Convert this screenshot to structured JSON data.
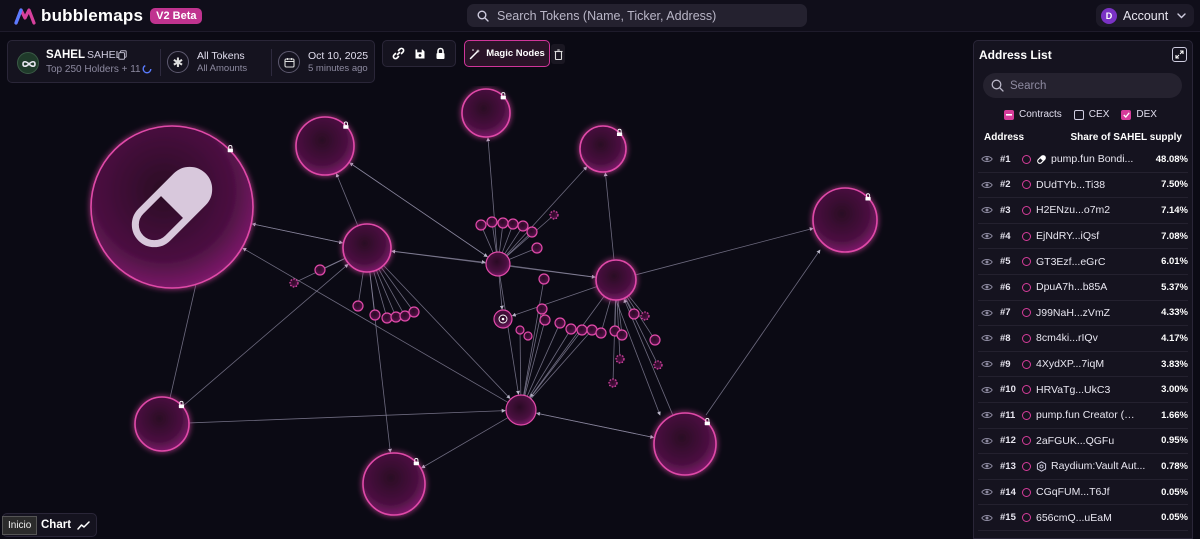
{
  "app": {
    "logo_text": "bubblemaps",
    "badge": "V2 Beta",
    "search_placeholder": "Search Tokens (Name, Ticker, Address)",
    "account_initial": "D",
    "account_label": "Account"
  },
  "token": {
    "name": "SAHEL",
    "ticker": "SAHEL",
    "holders": "Top 250 Holders + 11",
    "filter_label": "All Tokens",
    "filter_sub": "All Amounts",
    "date_label": "Oct 10, 2025",
    "date_sub": "5 minutes ago"
  },
  "toolbar": {
    "magic_nodes": "Magic Nodes"
  },
  "bottom": {
    "chart_label": "Chart",
    "tooltip": "Inicio"
  },
  "address_list": {
    "title": "Address List",
    "search_placeholder": "Search",
    "filters": [
      "Contracts",
      "CEX",
      "DEX"
    ],
    "col_address": "Address",
    "col_share": "Share of SAHEL supply",
    "rows": [
      {
        "rank": "#1",
        "name": "pump.fun Bondi...",
        "share": "48.08%",
        "icon": "pill-icon"
      },
      {
        "rank": "#2",
        "name": "DUdTYb...Ti38",
        "share": "7.50%"
      },
      {
        "rank": "#3",
        "name": "H2ENzu...o7m2",
        "share": "7.14%"
      },
      {
        "rank": "#4",
        "name": "EjNdRY...iQsf",
        "share": "7.08%"
      },
      {
        "rank": "#5",
        "name": "GT3Ezf...eGrC",
        "share": "6.01%"
      },
      {
        "rank": "#6",
        "name": "DpuA7h...b85A",
        "share": "5.37%"
      },
      {
        "rank": "#7",
        "name": "J99NaH...zVmZ",
        "share": "4.33%"
      },
      {
        "rank": "#8",
        "name": "8cm4ki...rIQv",
        "share": "4.17%"
      },
      {
        "rank": "#9",
        "name": "4XydXP...7iqM",
        "share": "3.83%"
      },
      {
        "rank": "#10",
        "name": "HRVaTg...UkC3",
        "share": "3.00%"
      },
      {
        "rank": "#11",
        "name": "pump.fun Creator (4H...",
        "share": "1.66%"
      },
      {
        "rank": "#12",
        "name": "2aFGUK...QGFu",
        "share": "0.95%"
      },
      {
        "rank": "#13",
        "name": "Raydium:Vault Aut...",
        "share": "0.78%",
        "icon": "hexagon-icon"
      },
      {
        "rank": "#14",
        "name": "CGqFUM...T6Jf",
        "share": "0.05%"
      },
      {
        "rank": "#15",
        "name": "656cmQ...uEaM",
        "share": "0.05%"
      }
    ]
  },
  "colors": {
    "accent": "#d63c9a",
    "bubble_fill": "#4a1040",
    "bubble_stroke": "#e04aa8",
    "background": "#0b0a14"
  }
}
